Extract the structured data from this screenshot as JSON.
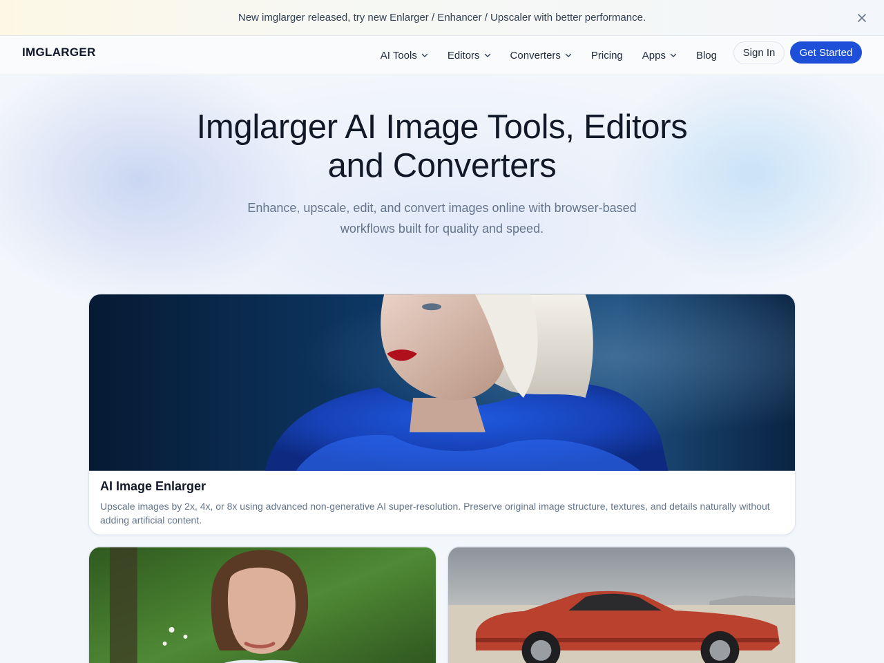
{
  "announcement": {
    "text": "New imglarger released, try new Enlarger / Enhancer / Upscaler with better performance.",
    "close_icon": "close-icon"
  },
  "nav": {
    "logo": "IMGLARGER",
    "items": [
      {
        "label": "AI Tools",
        "dropdown": true
      },
      {
        "label": "Editors",
        "dropdown": true
      },
      {
        "label": "Converters",
        "dropdown": true
      },
      {
        "label": "Pricing",
        "dropdown": false
      },
      {
        "label": "Apps",
        "dropdown": true
      },
      {
        "label": "Blog",
        "dropdown": false
      }
    ],
    "sign_in": "Sign In",
    "get_started": "Get Started"
  },
  "hero": {
    "title_line1": "Imglarger AI Image Tools, Editors",
    "title_line2": "and Converters",
    "subtitle_line1": "Enhance, upscale, edit, and convert images online with browser-based",
    "subtitle_line2": "workflows built for quality and speed."
  },
  "cards": [
    {
      "title": "AI Image Enlarger",
      "description": "Upscale images by 2x, 4x, or 8x using advanced non-generative AI super-resolution. Preserve original image structure, textures, and details naturally without adding artificial content.",
      "image": "portrait-blue-ruff"
    },
    {
      "image": "woman-portrait-garden"
    },
    {
      "image": "red-muscle-car-desert"
    }
  ],
  "colors": {
    "accent": "#1d4fd8",
    "text": "#0f172a",
    "muted": "#64748b"
  }
}
